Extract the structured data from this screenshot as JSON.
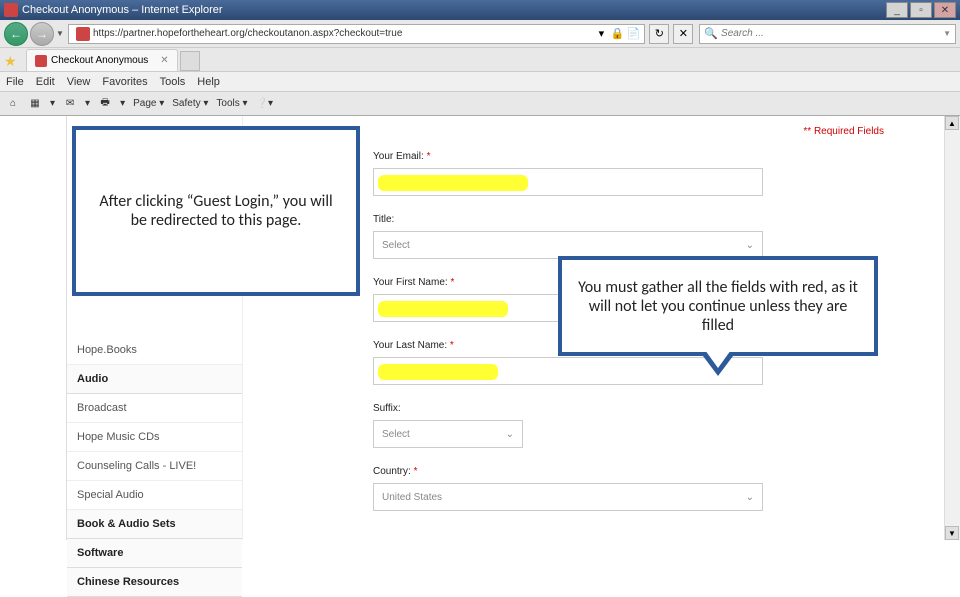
{
  "window": {
    "title": "Checkout Anonymous – Internet Explorer",
    "min": "_",
    "max": "▫",
    "close": "✕"
  },
  "nav": {
    "url": "https://partner.hopefortheheart.org/checkoutanon.aspx?checkout=true",
    "search_placeholder": "Search ..."
  },
  "tab": {
    "label": "Checkout Anonymous",
    "close": "✕"
  },
  "menus": [
    "File",
    "Edit",
    "View",
    "Favorites",
    "Tools",
    "Help"
  ],
  "toolbar": {
    "home": "⌂",
    "feeds": "▦",
    "mail": "✉",
    "print": "🖶",
    "page": "Page ▾",
    "safety": "Safety ▾",
    "tools": "Tools ▾",
    "help": "❔▾"
  },
  "sidebar": {
    "items": [
      {
        "type": "item",
        "label": "Hope.Books"
      },
      {
        "type": "group",
        "label": "Audio"
      },
      {
        "type": "item",
        "label": "Broadcast"
      },
      {
        "type": "item",
        "label": "Hope Music CDs"
      },
      {
        "type": "item",
        "label": "Counseling Calls - LIVE!"
      },
      {
        "type": "item",
        "label": "Special Audio"
      },
      {
        "type": "group",
        "label": "Book & Audio Sets"
      },
      {
        "type": "group",
        "label": "Software"
      },
      {
        "type": "group",
        "label": "Chinese Resources"
      }
    ]
  },
  "form": {
    "required_note": "** Required Fields",
    "email_label": "Your Email:",
    "title_label": "Title:",
    "title_value": "Select",
    "first_label": "Your First Name:",
    "last_label": "Your Last Name:",
    "suffix_label": "Suffix:",
    "suffix_value": "Select",
    "country_label": "Country:",
    "country_value": "United States",
    "req_marker": "*",
    "chevron": "⌄"
  },
  "callouts": {
    "c1": "After clicking “Guest Login,” you will be redirected to this page.",
    "c2": "You must gather all the fields with red, as it will not let you continue unless they are filled"
  }
}
